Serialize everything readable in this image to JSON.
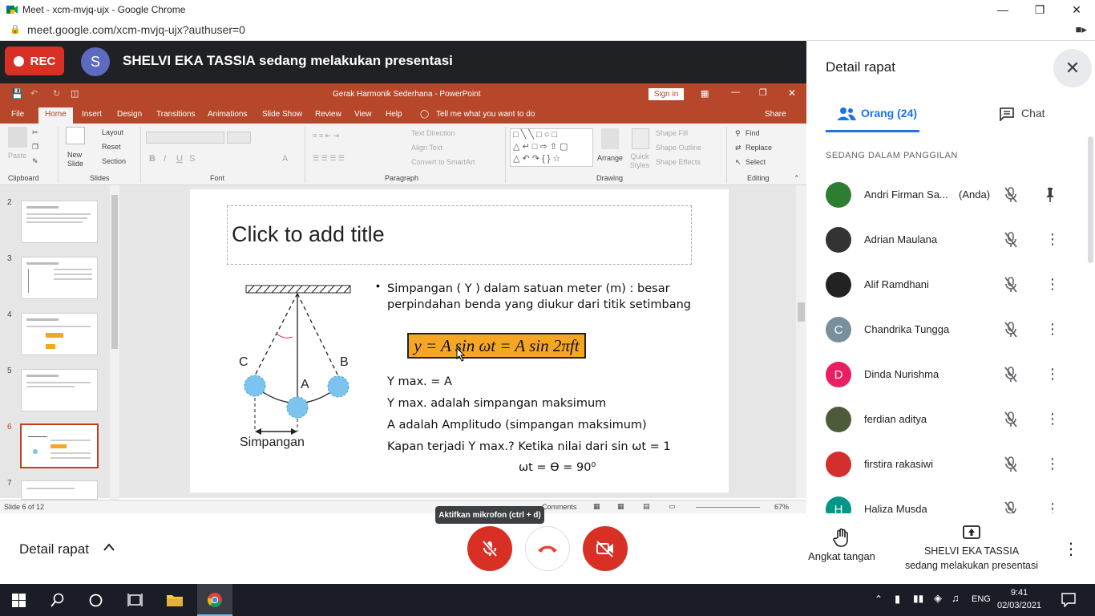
{
  "browser": {
    "window_title": "Meet - xcm-mvjq-ujx - Google Chrome",
    "url": "meet.google.com/xcm-mvjq-ujx?authuser=0"
  },
  "meet": {
    "rec_label": "REC",
    "presenter_initial": "S",
    "presenting_banner": "SHELVI EKA TASSIA sedang melakukan presentasi"
  },
  "ppt": {
    "title": "Gerak Harmonik Sederhana  -  PowerPoint",
    "signin": "Sign in",
    "share": "Share",
    "tell_me": "Tell me what you want to do",
    "tabs": [
      "File",
      "Home",
      "Insert",
      "Design",
      "Transitions",
      "Animations",
      "Slide Show",
      "Review",
      "View",
      "Help"
    ],
    "ribbon": {
      "paste": "Paste",
      "new_slide": "New Slide",
      "layout": "Layout",
      "reset": "Reset",
      "section": "Section",
      "text_direction": "Text Direction",
      "align_text": "Align Text",
      "convert_smartart": "Convert to SmartArt",
      "arrange": "Arrange",
      "quick_styles": "Quick Styles",
      "shape_fill": "Shape Fill",
      "shape_outline": "Shape Outline",
      "shape_effects": "Shape Effects",
      "find": "Find",
      "replace": "Replace",
      "select": "Select",
      "groups": [
        "Clipboard",
        "Slides",
        "Font",
        "Paragraph",
        "Drawing",
        "Editing"
      ]
    },
    "thumb_numbers": [
      "2",
      "3",
      "4",
      "5",
      "6",
      "7"
    ],
    "active_thumb": "6",
    "slide": {
      "title_placeholder": "Click to add title",
      "bullet": "Simpangan ( Y ) dalam satuan meter (m) : besar perpindahan benda yang diukur dari titik setimbang",
      "formula": "y = A sin ωt = A sin 2πft",
      "lines": [
        "Y max. = A",
        "Y max. adalah simpangan maksimum",
        "A adalah Amplitudo (simpangan maksimum)",
        "Kapan terjadi Y max.? Ketika nilai dari sin ωt = 1"
      ],
      "last_line": "ωt = Ө = 90⁰",
      "pendulum": {
        "label_c": "C",
        "label_a": "A",
        "label_b": "B",
        "label_simpangan": "Simpangan"
      }
    },
    "status": {
      "slide_count": "Slide 6 of 12",
      "comments": "Comments",
      "zoom": "67%"
    }
  },
  "panel": {
    "title": "Detail rapat",
    "tab_people": "Orang (24)",
    "tab_chat": "Chat",
    "section": "SEDANG DALAM PANGGILAN",
    "you_label": "(Anda)",
    "participants": [
      {
        "name": "Andri Firman Sa...",
        "initial": "",
        "color": "#2e7d32"
      },
      {
        "name": "Adrian Maulana",
        "initial": "",
        "color": "#333333"
      },
      {
        "name": "Alif Ramdhani",
        "initial": "",
        "color": "#222222"
      },
      {
        "name": "Chandrika Tungga",
        "initial": "C",
        "color": "#78909c"
      },
      {
        "name": "Dinda Nurishma",
        "initial": "D",
        "color": "#e91e63"
      },
      {
        "name": "ferdian aditya",
        "initial": "",
        "color": "#4e5b3a"
      },
      {
        "name": "firstira rakasiwi",
        "initial": "",
        "color": "#d32f2f"
      },
      {
        "name": "Haliza Musda",
        "initial": "H",
        "color": "#009688"
      }
    ]
  },
  "bottom": {
    "details": "Detail rapat",
    "tooltip": "Aktifkan mikrofon (ctrl + d)",
    "raise_hand": "Angkat tangan",
    "presenter_name": "SHELVI EKA TASSIA",
    "presenting_sub": "sedang melakukan presentasi"
  },
  "taskbar": {
    "lang": "ENG",
    "time": "9:41",
    "date": "02/03/2021"
  },
  "colors": {
    "meet_red": "#ea4335",
    "ppt_accent": "#b7472a",
    "active_blue": "#1a73e8"
  }
}
